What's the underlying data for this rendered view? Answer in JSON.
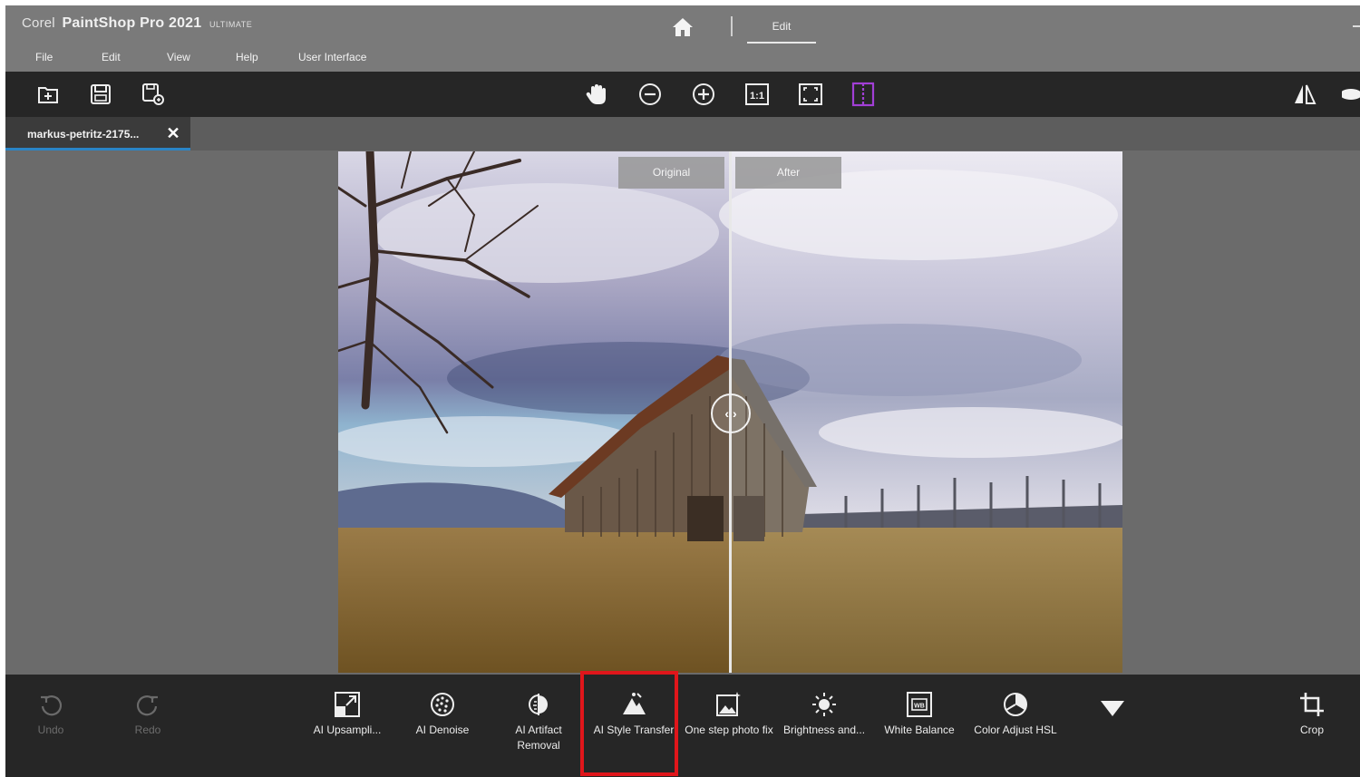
{
  "app": {
    "brand": "Corel",
    "name": "PaintShop Pro 2021",
    "edition": "ULTIMATE"
  },
  "menu": [
    "File",
    "Edit",
    "View",
    "Help",
    "User Interface"
  ],
  "mode_tabs": {
    "active": "Edit"
  },
  "toolbar": {
    "left": [
      "new-icon",
      "save-icon",
      "save-as-icon"
    ],
    "center": [
      "pan-icon",
      "zoom-out-icon",
      "zoom-in-icon",
      "actual-size-icon",
      "fit-icon",
      "compare-view-icon"
    ],
    "right": [
      "mirror-icon",
      "more-icon"
    ],
    "zoom_1to1": "1:1",
    "accent": "#a23fd6"
  },
  "document_tab": {
    "name": "markus-petritz-2175...",
    "close": "✕"
  },
  "compare": {
    "original": "Original",
    "after": "After",
    "handle": "‹ ›"
  },
  "bottom_tools": [
    {
      "id": "undo",
      "icon": "undo-icon",
      "label": "Undo",
      "enabled": false
    },
    {
      "id": "redo",
      "icon": "redo-icon",
      "label": "Redo",
      "enabled": false
    },
    {
      "id": "ai-upsampling",
      "icon": "upsample-icon",
      "label": "AI Upsampli...",
      "enabled": true
    },
    {
      "id": "ai-denoise",
      "icon": "denoise-icon",
      "label": "AI Denoise",
      "enabled": true
    },
    {
      "id": "ai-artifact-removal",
      "icon": "artifact-icon",
      "label": "AI Artifact Removal",
      "enabled": true
    },
    {
      "id": "ai-style-transfer",
      "icon": "style-transfer-icon",
      "label": "AI Style Transfer",
      "enabled": true,
      "highlighted": true
    },
    {
      "id": "one-step-photo-fix",
      "icon": "photo-fix-icon",
      "label": "One step photo fix",
      "enabled": true
    },
    {
      "id": "brightness",
      "icon": "brightness-icon",
      "label": "Brightness and...",
      "enabled": true
    },
    {
      "id": "white-balance",
      "icon": "white-balance-icon",
      "label": "White Balance",
      "enabled": true
    },
    {
      "id": "color-adjust-hsl",
      "icon": "hsl-icon",
      "label": "Color Adjust HSL",
      "enabled": true
    },
    {
      "id": "crop",
      "icon": "crop-icon",
      "label": "Crop",
      "enabled": true
    }
  ],
  "colors": {
    "highlight_box": "#e0161b",
    "tab_underline": "#2a84c6"
  }
}
